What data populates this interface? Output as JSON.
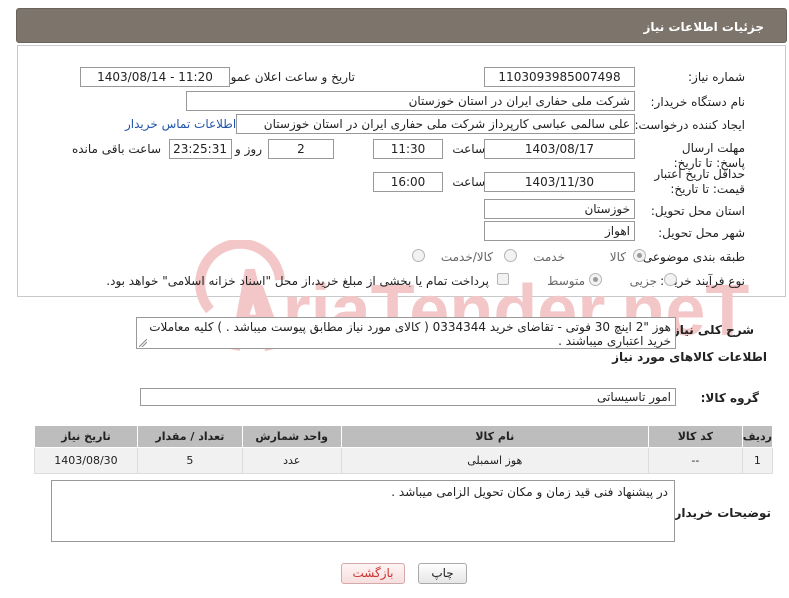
{
  "header": {
    "title": "جزئیات اطلاعات نیاز"
  },
  "form": {
    "need_number_label": "شماره نیاز:",
    "need_number": "1103093985007498",
    "announce_label": "تاریخ و ساعت اعلان عمومی:",
    "announce_value": "1403/08/14 - 11:20",
    "buyer_org_label": "نام دستگاه خریدار:",
    "buyer_org": "شرکت ملی حفاری ایران در استان خوزستان",
    "creator_label": "ایجاد کننده درخواست:",
    "creator": "علی سالمی عباسی کارپرداز شرکت ملی حفاری ایران در استان خوزستان",
    "contact_link": "اطلاعات تماس خریدار",
    "deadline_label": "مهلت ارسال پاسخ: تا تاریخ:",
    "deadline_date": "1403/08/17",
    "time_label": "ساعت",
    "deadline_time": "11:30",
    "days_value": "2",
    "days_label": "روز و",
    "remaining_time": "23:25:31",
    "remaining_label": "ساعت باقی مانده",
    "validity_label": "حداقل تاریخ اعتبار قیمت: تا تاریخ:",
    "validity_date": "1403/11/30",
    "validity_time": "16:00",
    "province_label": "استان محل تحویل:",
    "province": "خوزستان",
    "city_label": "شهر محل تحویل:",
    "city": "اهواز",
    "category_label": "طبقه بندی موضوعی:",
    "category_options": [
      "کالا",
      "خدمت",
      "کالا/خدمت"
    ],
    "process_label": "نوع فرآیند خرید :",
    "process_options": [
      "جزیی",
      "متوسط"
    ],
    "payment_note": "پرداخت تمام یا بخشی از مبلغ خرید،از محل \"اسناد خزانه اسلامی\" خواهد بود."
  },
  "description": {
    "label": "شرح کلی نیاز:",
    "text": "هوز \"2 اینچ 30 فوتی - تقاضای خرید 0334344 ( کالای مورد نیاز مطابق پیوست میباشد . ) کلیه معاملات خرید اعتباری میباشند ."
  },
  "goods_section": {
    "title": "اطلاعات کالاهای مورد نیاز"
  },
  "goods_group": {
    "label": "گروه کالا:",
    "value": "امور تاسیساتی"
  },
  "table": {
    "headers": [
      "ردیف",
      "کد کالا",
      "نام کالا",
      "واحد شمارش",
      "تعداد / مقدار",
      "تاریخ نیاز"
    ],
    "rows": [
      [
        "1",
        "--",
        "هوز اسمبلی",
        "عدد",
        "5",
        "1403/08/30"
      ]
    ]
  },
  "notes": {
    "label": "توضیحات خریدار:",
    "text": "در پیشنهاد فنی قید زمان و مکان تحویل الزامی میباشد ."
  },
  "buttons": {
    "print": "چاپ",
    "back": "بازگشت"
  },
  "watermark": {
    "text": "AriaTender.neT"
  },
  "colors": {
    "header_bg": "#7d756c",
    "link": "#2255aa",
    "table_header": "#bdbdbd",
    "watermark": "#f3c7c7"
  }
}
